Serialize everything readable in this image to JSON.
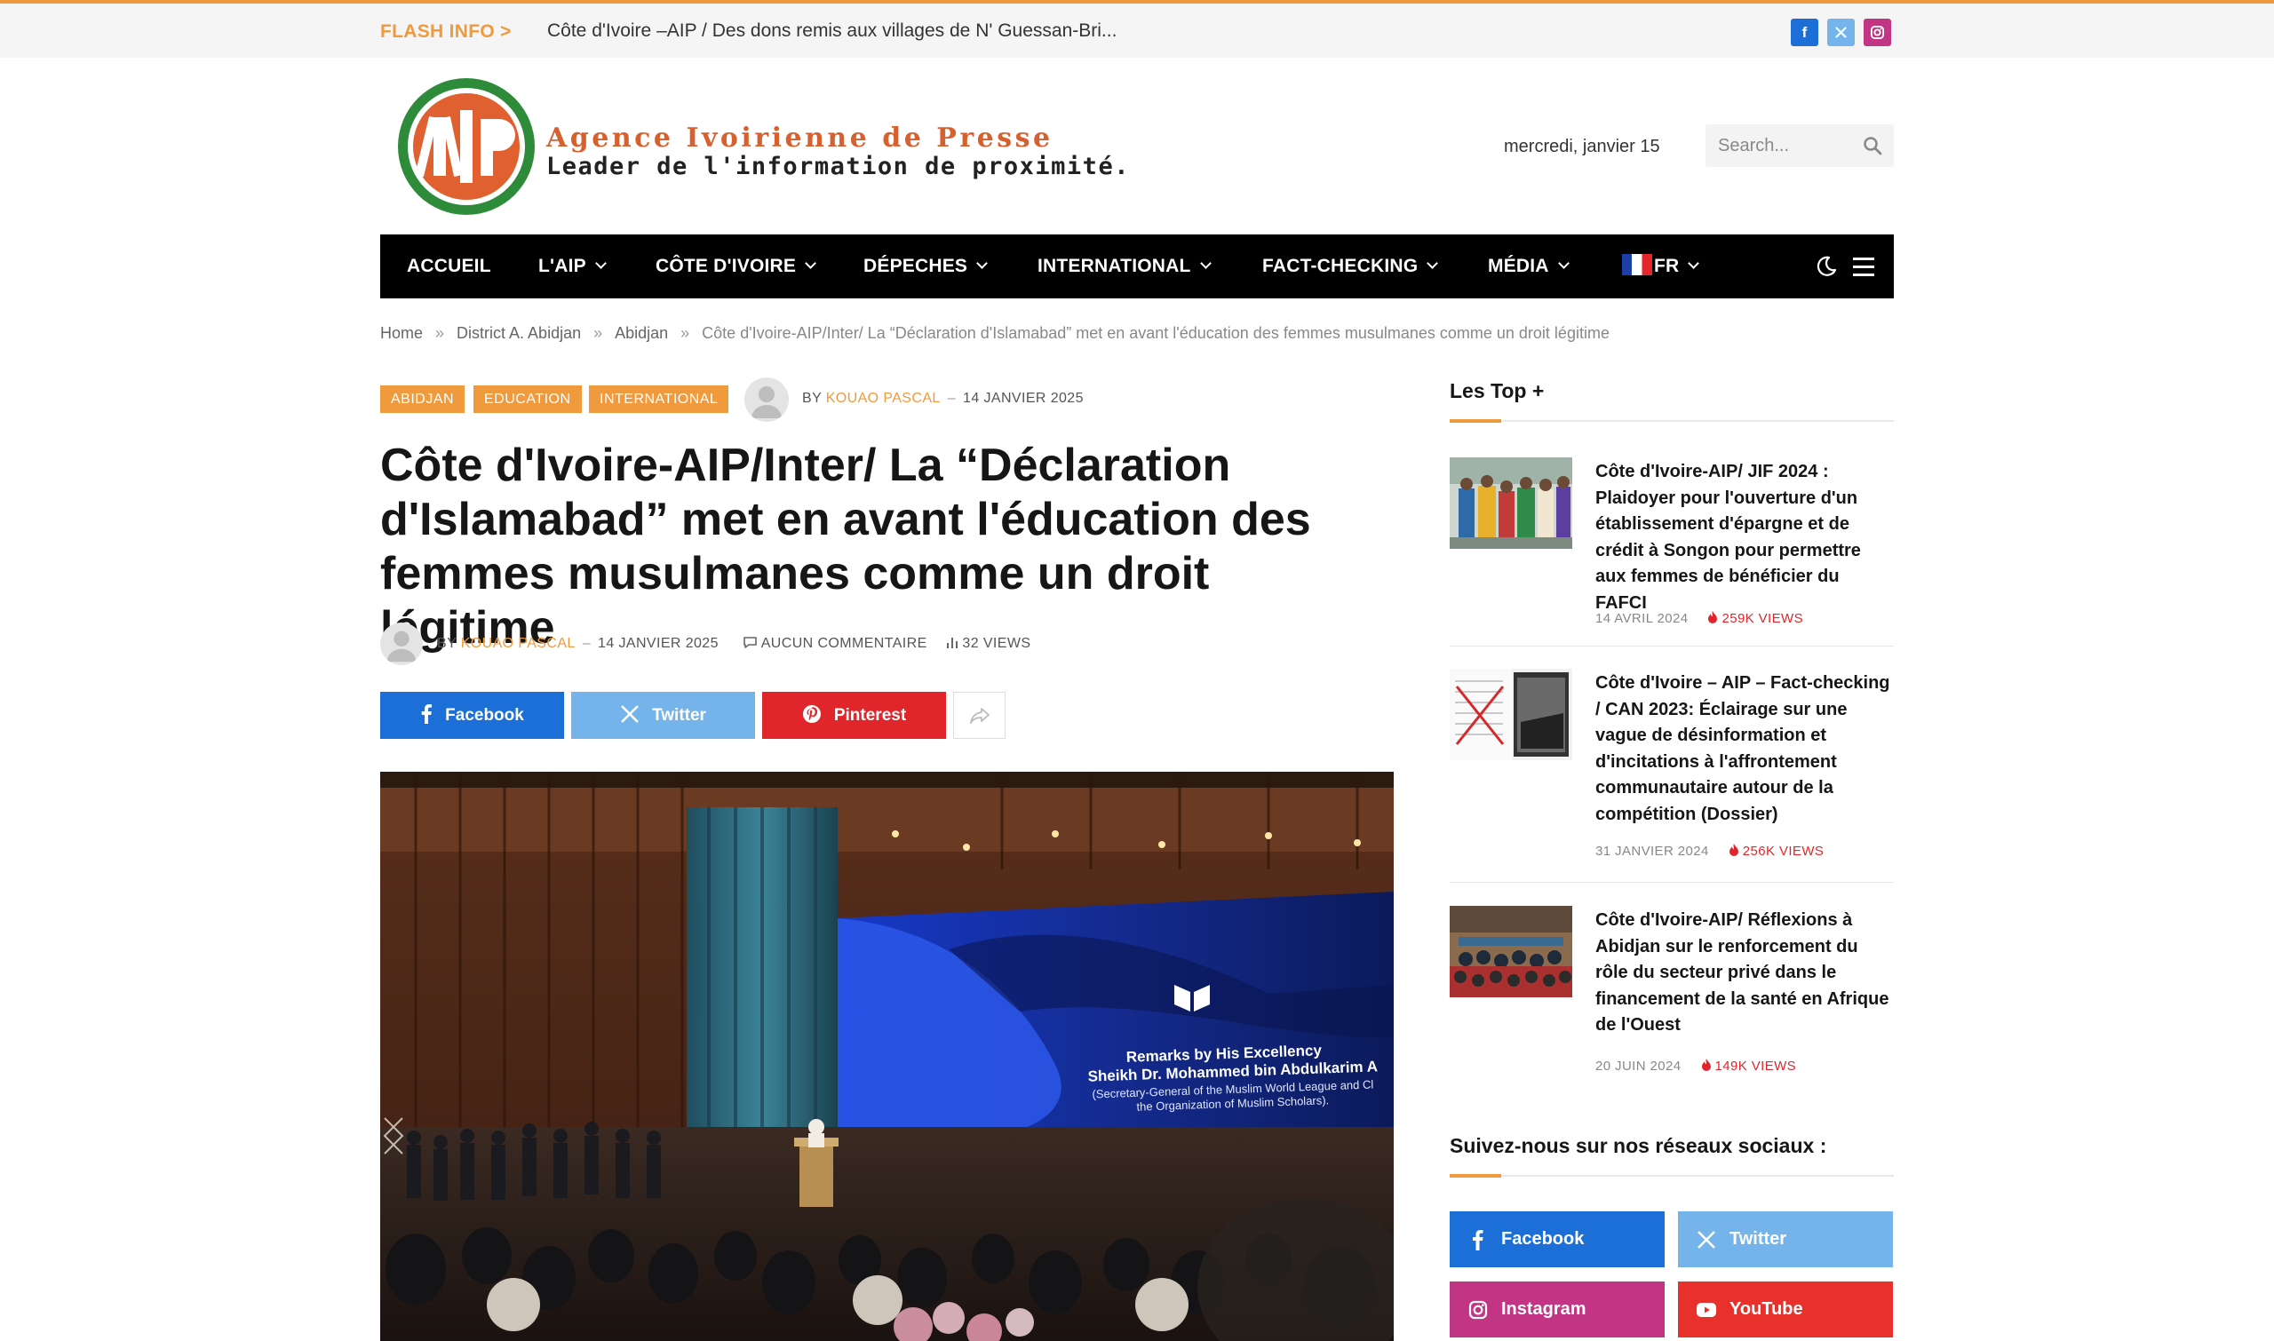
{
  "topbar": {
    "flash_label": "FLASH INFO >",
    "flash_text": "Côte d'Ivoire –AIP / Des dons remis aux villages de N' Guessan-Bri...",
    "social_icons": [
      "facebook-icon",
      "x-icon",
      "instagram-icon"
    ]
  },
  "header": {
    "logo_line1": "Agence Ivoirienne de Presse",
    "logo_line2": "Leader de l'information de proximité.",
    "logo_mark": "AIP",
    "date": "mercredi, janvier 15",
    "search_placeholder": "Search..."
  },
  "nav": {
    "items": [
      {
        "label": "ACCUEIL",
        "has_dropdown": false
      },
      {
        "label": "L'AIP",
        "has_dropdown": true
      },
      {
        "label": "CÔTE D'IVOIRE",
        "has_dropdown": true
      },
      {
        "label": "DÉPECHES",
        "has_dropdown": true
      },
      {
        "label": "INTERNATIONAL",
        "has_dropdown": true
      },
      {
        "label": "FACT-CHECKING",
        "has_dropdown": true
      },
      {
        "label": "MÉDIA",
        "has_dropdown": true
      },
      {
        "label": "FR",
        "has_dropdown": true
      }
    ]
  },
  "breadcrumb": {
    "items": [
      "Home",
      "District A. Abidjan",
      "Abidjan"
    ],
    "separator": "»",
    "current": "Côte d'Ivoire-AIP/Inter/ La “Déclaration d'Islamabad” met en avant l'éducation des femmes musulmanes comme un droit légitime"
  },
  "article": {
    "categories": [
      "ABIDJAN",
      "EDUCATION",
      "INTERNATIONAL"
    ],
    "by": "BY",
    "author": "KOUAO PASCAL",
    "date": "14 JANVIER 2025",
    "title": "Côte d'Ivoire-AIP/Inter/ La “Déclaration d'Islamabad” met en avant l'éducation des femmes musulmanes comme un droit légitime",
    "comments": "AUCUN COMMENTAIRE",
    "views": "32 VIEWS",
    "share": {
      "facebook": "Facebook",
      "twitter": "Twitter",
      "pinterest": "Pinterest"
    },
    "hero_caption_lines": [
      "Remarks by His Excellency",
      "Sheikh Dr. Mohammed bin Abdulkarim A",
      "(Secretary-General of the Muslim World League and Cl",
      "the Organization of Muslim Scholars)."
    ]
  },
  "sidebar": {
    "top_heading": "Les Top +",
    "top_posts": [
      {
        "title": "Côte d'Ivoire-AIP/ JIF 2024 : Plaidoyer pour l'ouverture d'un établissement d'épargne et de crédit à Songon pour permettre aux femmes de bénéficier du FAFCI",
        "date": "14 AVRIL 2024",
        "views": "259K VIEWS"
      },
      {
        "title": "Côte d'Ivoire – AIP – Fact-checking / CAN 2023: Éclairage sur une vague de désinformation et d'incitations à l'affrontement communautaire autour de la compétition (Dossier)",
        "date": "31 JANVIER 2024",
        "views": "256K VIEWS"
      },
      {
        "title": "Côte d'Ivoire-AIP/ Réflexions à Abidjan sur le renforcement du rôle du secteur privé dans le financement de la santé en Afrique de l'Ouest",
        "date": "20 JUIN 2024",
        "views": "149K VIEWS"
      }
    ],
    "social_heading": "Suivez-nous sur nos réseaux sociaux :",
    "social": {
      "facebook": "Facebook",
      "twitter": "Twitter",
      "instagram": "Instagram",
      "youtube": "YouTube"
    }
  },
  "colors": {
    "accent": "#ef9a3c",
    "nav_bg": "#000000",
    "facebook": "#1d6fd8",
    "twitter": "#74b4ea",
    "pinterest": "#e1262b",
    "instagram": "#c13584",
    "youtube": "#e8312a"
  }
}
